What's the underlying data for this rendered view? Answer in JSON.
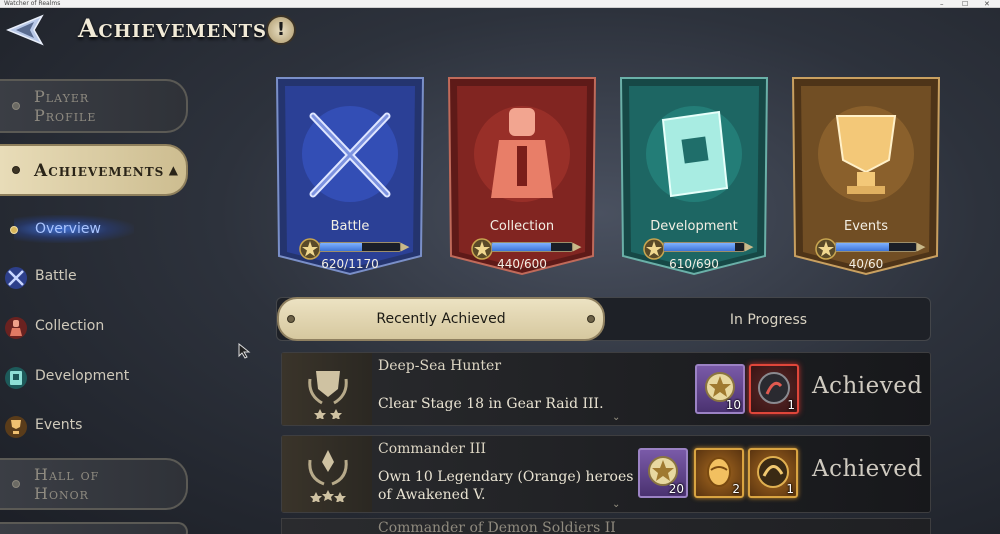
{
  "window": {
    "title": "Watcher of Realms",
    "controls": [
      "–",
      "☐",
      "✕"
    ]
  },
  "header": {
    "title": "Achievements",
    "help_symbol": "!"
  },
  "sidebar": {
    "player_profile": "Player Profile",
    "achievements": "Achievements",
    "expand_symbol": "▲",
    "overview": "Overview",
    "battle": "Battle",
    "collection": "Collection",
    "development": "Development",
    "events": "Events",
    "hall_of_honor": "Hall of Honor"
  },
  "categories": [
    {
      "name": "Battle",
      "progress": "620/1170",
      "value": 620,
      "max": 1170,
      "color": "#2f4fa8"
    },
    {
      "name": "Collection",
      "progress": "440/600",
      "value": 440,
      "max": 600,
      "color": "#8e2a26"
    },
    {
      "name": "Development",
      "progress": "610/690",
      "value": 610,
      "max": 690,
      "color": "#1f6e6a"
    },
    {
      "name": "Events",
      "progress": "40/60",
      "value": 40,
      "max": 60,
      "color": "#7a5528"
    }
  ],
  "tabs": {
    "recently_achieved": "Recently Achieved",
    "in_progress": "In Progress"
  },
  "achievements": [
    {
      "title": "Deep-Sea Hunter",
      "description": "Clear Stage 18 in Gear Raid III.",
      "rewards": [
        {
          "quantity": "10",
          "type": "purple"
        },
        {
          "quantity": "1",
          "type": "red"
        }
      ],
      "status": "Achieved"
    },
    {
      "title": "Commander III",
      "description": "Own 10 Legendary (Orange) heroes of Awakened V.",
      "rewards": [
        {
          "quantity": "20",
          "type": "purple"
        },
        {
          "quantity": "2",
          "type": "gold"
        },
        {
          "quantity": "1",
          "type": "gold"
        }
      ],
      "status": "Achieved"
    },
    {
      "title": "Commander of Demon Soldiers II"
    }
  ],
  "expand_chevron": "⌄"
}
